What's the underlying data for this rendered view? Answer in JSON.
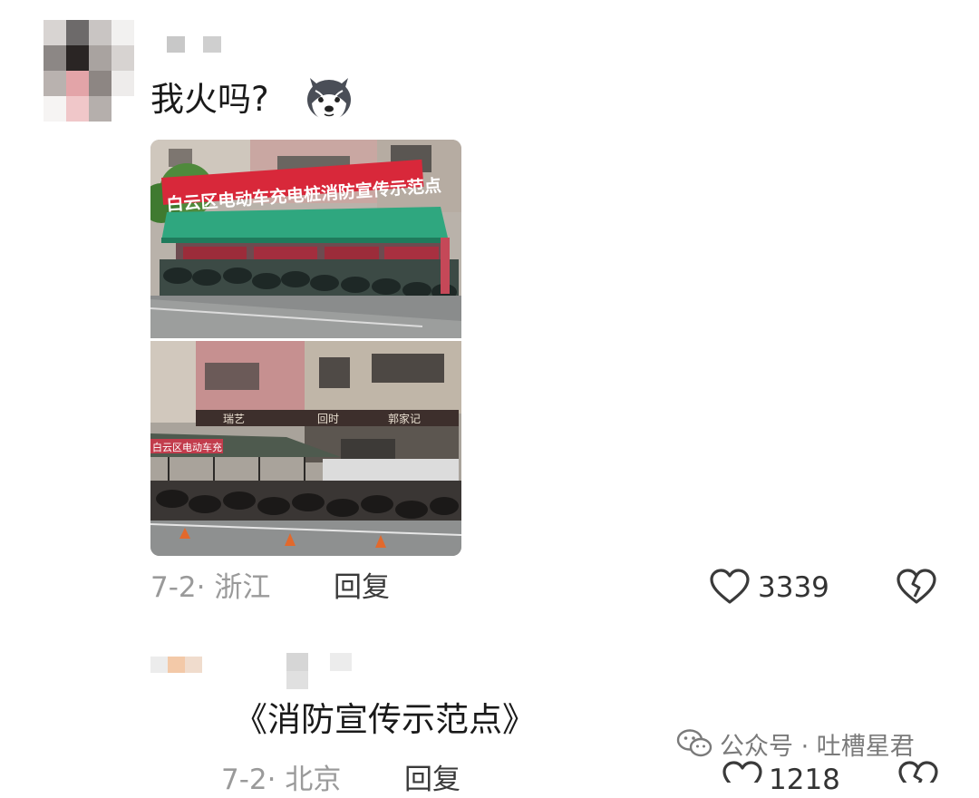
{
  "comment1": {
    "text": "我火吗?",
    "emoji_icon": "husky-dog-emoji",
    "photo_top": {
      "banner_text": "白云区电动车充电桩消防宣传示范点"
    },
    "photo_bottom": {
      "banner_text": "白云区电动车充",
      "shop_sign_left": "瑞艺",
      "shop_sign_mid": "回时",
      "shop_sign_right": "郭家记"
    },
    "date_location": "7-2· 浙江",
    "reply_label": "回复",
    "like_count": "3339",
    "like_icon": "heart-outline-icon",
    "dislike_icon": "broken-heart-icon"
  },
  "comment2": {
    "text": "《消防宣传示范点》",
    "date_location": "7-2· 北京",
    "reply_label": "回复",
    "like_count": "1218"
  },
  "watermark": {
    "icon": "wechat-icon",
    "text": "公众号 · 吐槽星君"
  }
}
